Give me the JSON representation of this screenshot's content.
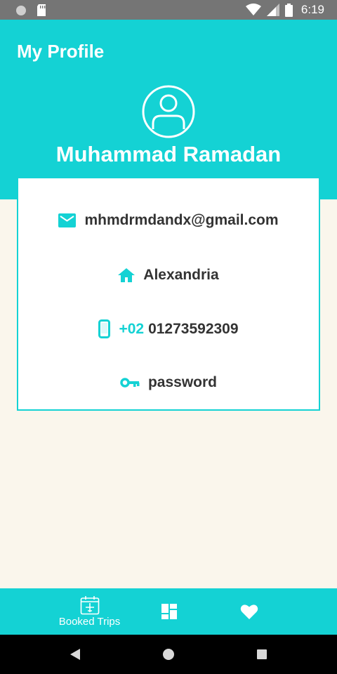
{
  "status_bar": {
    "time": "6:19"
  },
  "header": {
    "title": "My Profile",
    "user_name": "Muhammad Ramadan"
  },
  "profile": {
    "email": "mhmdrmdandx@gmail.com",
    "city": "Alexandria",
    "phone_prefix": "+02",
    "phone": "01273592309",
    "password": "password"
  },
  "bottom_nav": {
    "items": [
      {
        "label": "Booked Trips",
        "icon": "calendar-plane-icon"
      },
      {
        "label": "",
        "icon": "dashboard-icon"
      },
      {
        "label": "",
        "icon": "heart-icon"
      }
    ]
  },
  "colors": {
    "accent": "#14d2d4",
    "background": "#faf6ec",
    "text": "#333333"
  }
}
